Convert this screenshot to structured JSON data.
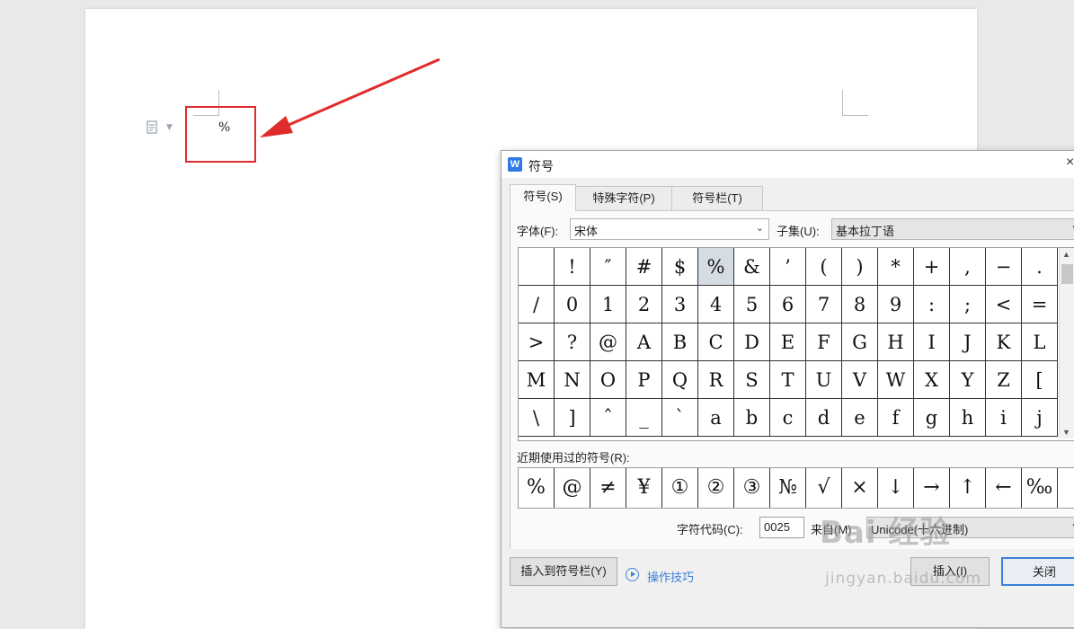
{
  "document": {
    "inserted_text": "%"
  },
  "dialog": {
    "title": "符号",
    "close_glyph": "×",
    "tabs": [
      {
        "label": "符号(S)"
      },
      {
        "label": "特殊字符(P)"
      },
      {
        "label": "符号栏(T)"
      }
    ],
    "font_label": "字体(F):",
    "font_value": "宋体",
    "subset_label": "子集(U):",
    "subset_value": "基本拉丁语",
    "symbols": [
      " ",
      "!",
      "″",
      "#",
      "$",
      "%",
      "&",
      "’",
      "(",
      ")",
      "*",
      "+",
      ",",
      "−",
      ".",
      "/",
      "0",
      "1",
      "2",
      "3",
      "4",
      "5",
      "6",
      "7",
      "8",
      "9",
      ":",
      ";",
      "<",
      "=",
      ">",
      "?",
      "@",
      "A",
      "B",
      "C",
      "D",
      "E",
      "F",
      "G",
      "H",
      "I",
      "J",
      "K",
      "L",
      "M",
      "N",
      "O",
      "P",
      "Q",
      "R",
      "S",
      "T",
      "U",
      "V",
      "W",
      "X",
      "Y",
      "Z",
      "[",
      "\\",
      "]",
      "ˆ",
      "_",
      "`",
      "a",
      "b",
      "c",
      "d",
      "e",
      "f",
      "g",
      "h",
      "i",
      "j"
    ],
    "selected_symbol": "%",
    "recent_label": "近期使用过的符号(R):",
    "recent_symbols": [
      "%",
      "@",
      "≠",
      "¥",
      "①",
      "②",
      "③",
      "№",
      "√",
      "×",
      "↓",
      "→",
      "↑",
      "←",
      "‰"
    ],
    "char_code_label": "字符代码(C):",
    "char_code_value": "0025",
    "from_label": "来自(M)",
    "from_value": "Unicode(十六进制)",
    "insert_to_bar_button": "插入到符号栏(Y)",
    "tips_link": "操作技巧",
    "insert_button": "插入(I)",
    "close_button": "关闭"
  },
  "watermark": {
    "main": "Bai 经验",
    "sub": "jingyan.baidu.com"
  },
  "colors": {
    "highlight": "#e02b2b",
    "accent": "#3c7fd8",
    "selected_cell": "#d6dce4"
  }
}
